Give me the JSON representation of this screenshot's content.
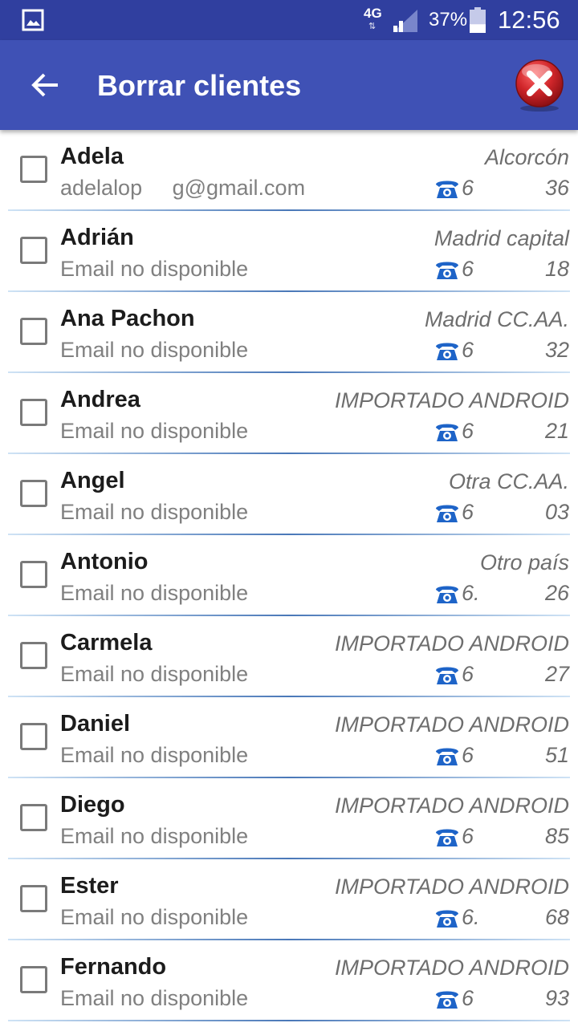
{
  "status_bar": {
    "network": "4G",
    "network_arrows": "⇅",
    "battery_percent": "37%",
    "battery_level": 0.37,
    "time": "12:56"
  },
  "app_bar": {
    "title": "Borrar clientes",
    "back_icon": "arrow-back-icon",
    "close_icon": "close-icon"
  },
  "colors": {
    "status_bar": "#303f9f",
    "app_bar": "#3f51b5",
    "close_button": "#d0262a",
    "phone_icon": "#1e64c8"
  },
  "clients": [
    {
      "name": "Adela",
      "email": "adelalop     g@gmail.com",
      "region": "Alcorcón",
      "phone_start": "6",
      "phone_end": "36"
    },
    {
      "name": "Adrián",
      "email": "Email no disponible",
      "region": "Madrid capital",
      "phone_start": "6",
      "phone_end": "18"
    },
    {
      "name": "Ana Pachon",
      "email": "Email no disponible",
      "region": "Madrid CC.AA.",
      "phone_start": "6",
      "phone_end": "32"
    },
    {
      "name": "Andrea",
      "email": "Email no disponible",
      "region": "IMPORTADO ANDROID",
      "phone_start": "6",
      "phone_end": "21"
    },
    {
      "name": "Angel",
      "email": "Email no disponible",
      "region": "Otra CC.AA.",
      "phone_start": "6",
      "phone_end": "03"
    },
    {
      "name": "Antonio",
      "email": "Email no disponible",
      "region": "Otro país",
      "phone_start": "6.",
      "phone_end": "26"
    },
    {
      "name": "Carmela",
      "email": "Email no disponible",
      "region": "IMPORTADO ANDROID",
      "phone_start": "6",
      "phone_end": "27"
    },
    {
      "name": "Daniel",
      "email": "Email no disponible",
      "region": "IMPORTADO ANDROID",
      "phone_start": "6",
      "phone_end": "51"
    },
    {
      "name": "Diego",
      "email": "Email no disponible",
      "region": "IMPORTADO ANDROID",
      "phone_start": "6",
      "phone_end": "85"
    },
    {
      "name": "Ester",
      "email": "Email no disponible",
      "region": "IMPORTADO ANDROID",
      "phone_start": "6.",
      "phone_end": "68"
    },
    {
      "name": "Fernando",
      "email": "Email no disponible",
      "region": "IMPORTADO ANDROID",
      "phone_start": "6",
      "phone_end": "93"
    }
  ]
}
